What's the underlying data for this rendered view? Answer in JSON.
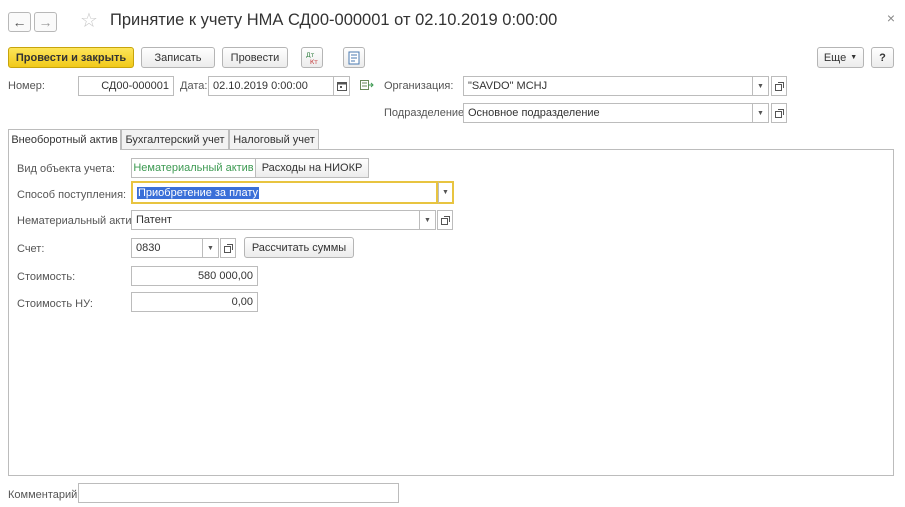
{
  "window": {
    "title": "Принятие к учету НМА СД00-000001 от 02.10.2019 0:00:00",
    "close": "×",
    "back": "←",
    "forward": "→",
    "star": "☆"
  },
  "toolbar": {
    "post_close": "Провести и закрыть",
    "save": "Записать",
    "post": "Провести",
    "more": "Еще",
    "help": "?"
  },
  "header": {
    "number_label": "Номер:",
    "number_value": "СД00-000001",
    "date_label": "Дата:",
    "date_value": "02.10.2019  0:00:00",
    "org_label": "Организация:",
    "org_value": "\"SAVDO\" MCHJ",
    "dept_label": "Подразделение:",
    "dept_value": "Основное подразделение"
  },
  "tabs": [
    "Внеоборотный актив",
    "Бухгалтерский учет",
    "Налоговый учет"
  ],
  "form": {
    "object_type_label": "Вид объекта учета:",
    "object_type_options": [
      "Нематериальный актив",
      "Расходы на НИОКР"
    ],
    "receipt_label": "Способ поступления:",
    "receipt_value": "Приобретение за плату",
    "asset_label": "Нематериальный актив:",
    "asset_value": "Патент",
    "account_label": "Счет:",
    "account_value": "0830",
    "calc_button": "Рассчитать суммы",
    "cost_label": "Стоимость:",
    "cost_value": "580 000,00",
    "cost_tax_label": "Стоимость НУ:",
    "cost_tax_value": "0,00"
  },
  "footer": {
    "comment_label": "Комментарий:",
    "comment_value": ""
  },
  "colors": {
    "primary_button": "#f1c919",
    "selected_segment_text": "#3d9a52",
    "focus_border": "#e8c440",
    "selection_bg": "#3a6fd8"
  },
  "icons": [
    "back-arrow-icon",
    "forward-arrow-icon",
    "star-icon",
    "dt-kt-icon",
    "report-icon",
    "calendar-icon",
    "post-arrow-icon",
    "dropdown-icon",
    "open-link-icon",
    "close-icon"
  ]
}
